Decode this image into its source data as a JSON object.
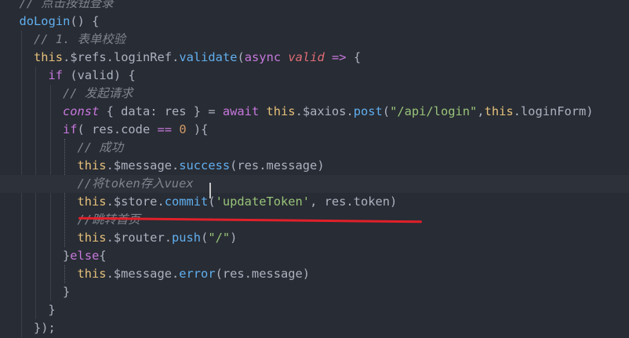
{
  "editor": {
    "language": "javascript",
    "lines": [
      {
        "indent": 1,
        "tokens": [
          {
            "t": "// 点击按钮登录",
            "c": "cm"
          }
        ]
      },
      {
        "indent": 1,
        "tokens": [
          {
            "t": "doLogin",
            "c": "fn"
          },
          {
            "t": "() {",
            "c": "pl"
          }
        ]
      },
      {
        "indent": 2,
        "tokens": [
          {
            "t": "// 1. 表单校验",
            "c": "cm"
          }
        ]
      },
      {
        "indent": 2,
        "tokens": [
          {
            "t": "this",
            "c": "th"
          },
          {
            "t": ".$refs.loginRef.",
            "c": "pl"
          },
          {
            "t": "validate",
            "c": "fn"
          },
          {
            "t": "(",
            "c": "pl"
          },
          {
            "t": "async",
            "c": "kw"
          },
          {
            "t": " ",
            "c": "pl"
          },
          {
            "t": "valid",
            "c": "prm"
          },
          {
            "t": " ",
            "c": "pl"
          },
          {
            "t": "=>",
            "c": "kw"
          },
          {
            "t": " {",
            "c": "pl"
          }
        ]
      },
      {
        "indent": 3,
        "tokens": [
          {
            "t": "if",
            "c": "kw"
          },
          {
            "t": " (valid) {",
            "c": "pl"
          }
        ]
      },
      {
        "indent": 4,
        "tokens": [
          {
            "t": "// 发起请求",
            "c": "cm"
          }
        ]
      },
      {
        "indent": 4,
        "tokens": [
          {
            "t": "const",
            "c": "kwi"
          },
          {
            "t": " { data: res } = ",
            "c": "pl"
          },
          {
            "t": "await",
            "c": "kw"
          },
          {
            "t": " ",
            "c": "pl"
          },
          {
            "t": "this",
            "c": "th"
          },
          {
            "t": ".$axios.",
            "c": "pl"
          },
          {
            "t": "post",
            "c": "fn"
          },
          {
            "t": "(",
            "c": "pl"
          },
          {
            "t": "\"/api/login\"",
            "c": "str"
          },
          {
            "t": ",",
            "c": "pl"
          },
          {
            "t": "this",
            "c": "th"
          },
          {
            "t": ".loginForm)",
            "c": "pl"
          }
        ]
      },
      {
        "indent": 4,
        "tokens": [
          {
            "t": "if",
            "c": "kw"
          },
          {
            "t": "( res.code ",
            "c": "pl"
          },
          {
            "t": "==",
            "c": "kw"
          },
          {
            "t": " ",
            "c": "pl"
          },
          {
            "t": "0",
            "c": "num"
          },
          {
            "t": " ){",
            "c": "pl"
          }
        ]
      },
      {
        "indent": 5,
        "tokens": [
          {
            "t": "// 成功",
            "c": "cm"
          }
        ]
      },
      {
        "indent": 5,
        "tokens": [
          {
            "t": "this",
            "c": "th"
          },
          {
            "t": ".$message.",
            "c": "pl"
          },
          {
            "t": "success",
            "c": "fn"
          },
          {
            "t": "(res.message)",
            "c": "pl"
          }
        ]
      },
      {
        "indent": 5,
        "tokens": [
          {
            "t": "//将token存入vuex",
            "c": "cm"
          }
        ],
        "active": true
      },
      {
        "indent": 5,
        "tokens": [
          {
            "t": "this",
            "c": "th"
          },
          {
            "t": ".$store.",
            "c": "pl"
          },
          {
            "t": "commit",
            "c": "fn"
          },
          {
            "t": "(",
            "c": "pl"
          },
          {
            "t": "'updateToken'",
            "c": "str"
          },
          {
            "t": ", res.token)",
            "c": "pl"
          }
        ],
        "underlined": true
      },
      {
        "indent": 5,
        "tokens": [
          {
            "t": "//跳转首页",
            "c": "cm"
          }
        ]
      },
      {
        "indent": 5,
        "tokens": [
          {
            "t": "this",
            "c": "th"
          },
          {
            "t": ".$router.",
            "c": "pl"
          },
          {
            "t": "push",
            "c": "fn"
          },
          {
            "t": "(",
            "c": "pl"
          },
          {
            "t": "\"/\"",
            "c": "str"
          },
          {
            "t": ")",
            "c": "pl"
          }
        ]
      },
      {
        "indent": 4,
        "tokens": [
          {
            "t": "}",
            "c": "pl"
          },
          {
            "t": "else",
            "c": "kw"
          },
          {
            "t": "{",
            "c": "pl"
          }
        ]
      },
      {
        "indent": 5,
        "tokens": [
          {
            "t": "this",
            "c": "th"
          },
          {
            "t": ".$message.",
            "c": "pl"
          },
          {
            "t": "error",
            "c": "fn"
          },
          {
            "t": "(res.message)",
            "c": "pl"
          }
        ]
      },
      {
        "indent": 4,
        "tokens": [
          {
            "t": "}",
            "c": "pl"
          }
        ]
      },
      {
        "indent": 3,
        "tokens": [
          {
            "t": "}",
            "c": "pl"
          }
        ]
      },
      {
        "indent": 2,
        "tokens": [
          {
            "t": "});",
            "c": "pl"
          }
        ]
      }
    ],
    "colors": {
      "background": "#282c34",
      "comment": "#7f848e",
      "keyword": "#c678dd",
      "function": "#61afef",
      "string": "#98c379",
      "number": "#d19a66",
      "this": "#e5c07b",
      "underline_mark": "#e0202a"
    }
  }
}
